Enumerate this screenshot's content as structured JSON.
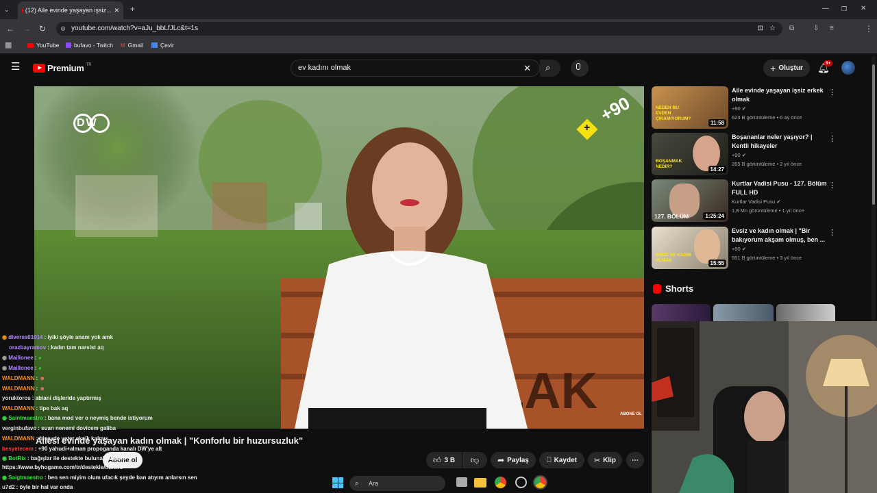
{
  "browser": {
    "tab_title": "(12) Aile evinde yaşayan işsiz...",
    "url": "youtube.com/watch?v=aJu_bbLfJLc&t=1s",
    "bookmarks": [
      "YouTube",
      "bufavo - Twitch",
      "Gmail",
      "Çevir"
    ]
  },
  "header": {
    "logo_text": "Premium",
    "logo_region": "TR",
    "search_value": "ev kadını olmak",
    "create_label": "Oluştur",
    "notif_badge": "9+"
  },
  "video": {
    "watermark_brand": "DW",
    "plus90_label": "+90",
    "corner_label": "ABONE OL",
    "bench_text": "LAK",
    "title": "Ailesi evinde yaşayan kadın olmak | \"Konforlu bir huzursuzluk\"",
    "subscribe_label": "Abone ol",
    "actions": {
      "likes": "3 B",
      "share": "Paylaş",
      "save": "Kaydet",
      "clip": "Klip"
    }
  },
  "recommendations": [
    {
      "title": "Aile evinde yaşayan işsiz erkek olmak",
      "channel": "+90",
      "meta": "624 B görüntüleme • 6 ay önce",
      "duration": "11:58",
      "thumb_text": "NEDEN BU EVDEN ÇIKAMIYORUM?",
      "thumb_color": "#b07a3a"
    },
    {
      "title": "Boşananlar neler yaşıyor? | Kentli hikayeler",
      "channel": "+90",
      "meta": "265 B görüntüleme • 2 yıl önce",
      "duration": "14:27",
      "thumb_text": "BOŞANMAK NEDİR?",
      "thumb_color": "#3a3a35"
    },
    {
      "title": "Kurtlar Vadisi Pusu - 127. Bölüm FULL HD",
      "channel": "Kurtlar Vadisi Pusu",
      "meta": "1,8 Mn görüntüleme • 1 yıl önce",
      "duration": "1:25:24",
      "thumb_text": "127. BÖLÜM",
      "thumb_color": "#6a5a4a"
    },
    {
      "title": "Evsiz ve kadın olmak | \"Bir bakıyorum akşam olmuş, ben ...",
      "channel": "+90",
      "meta": "551 B görüntüleme • 3 yıl önce",
      "duration": "15:55",
      "thumb_text": "EVSİZ VE KADIN OLMAK",
      "thumb_color": "#c9c2b0"
    }
  ],
  "shorts": {
    "label": "Shorts"
  },
  "chat": [
    {
      "user": "diversa01014",
      "color": "#b48bff",
      "text": ": iyiki şöyle anam yok amk"
    },
    {
      "user": "orazbayramov",
      "color": "#b48bff",
      "text": ": kadın tam narsist aq"
    },
    {
      "user": "Maillonee",
      "color": "#b48bff",
      "text": ":"
    },
    {
      "user": "Maillonee",
      "color": "#b48bff",
      "text": ":"
    },
    {
      "user": "WALDMANN",
      "color": "#ff8c1a",
      "text": ":"
    },
    {
      "user": "WALDMANN",
      "color": "#ff8c1a",
      "text": ":"
    },
    {
      "user": "yoruktoros",
      "color": "#e0e0e0",
      "text": ": abiani dişleride yaptırmış"
    },
    {
      "user": "WALDMANN",
      "color": "#ff8c1a",
      "text": ": tipe bak aq"
    },
    {
      "user": "Saintmaestro",
      "color": "#36e03c",
      "text": ": bana mod ver o neymiş bende istiyorum"
    },
    {
      "user": "verginbufavo",
      "color": "#e0e0e0",
      "text": ": suan nenemi dovicem galiba"
    },
    {
      "user": "WALDMANN",
      "color": "#ff8c1a",
      "text": ": bişeyde yeter eksik kalmış"
    },
    {
      "user": "besyetecem",
      "color": "#ff3b3b",
      "text": ": +90 yahudi+alman propoganda kanalı DW'ye alt"
    },
    {
      "user": "BotRix",
      "color": "#36e03c",
      "text": ": bağışlar ile destekte bulunabilirsiniz"
    },
    {
      "user": "",
      "color": "#e0e0e0",
      "text": "https://www.byhogame.com/tr/destekle/bufavo"
    },
    {
      "user": "Saigtmaestro",
      "color": "#36e03c",
      "text": ": ben sen miyim olum ufacık şeyde ban atıyım anlarsın sen"
    },
    {
      "user": "u7d2",
      "color": "#e0e0e0",
      "text": ": öyle bir hal var onda"
    }
  ],
  "taskbar": {
    "search_placeholder": "Ara"
  }
}
